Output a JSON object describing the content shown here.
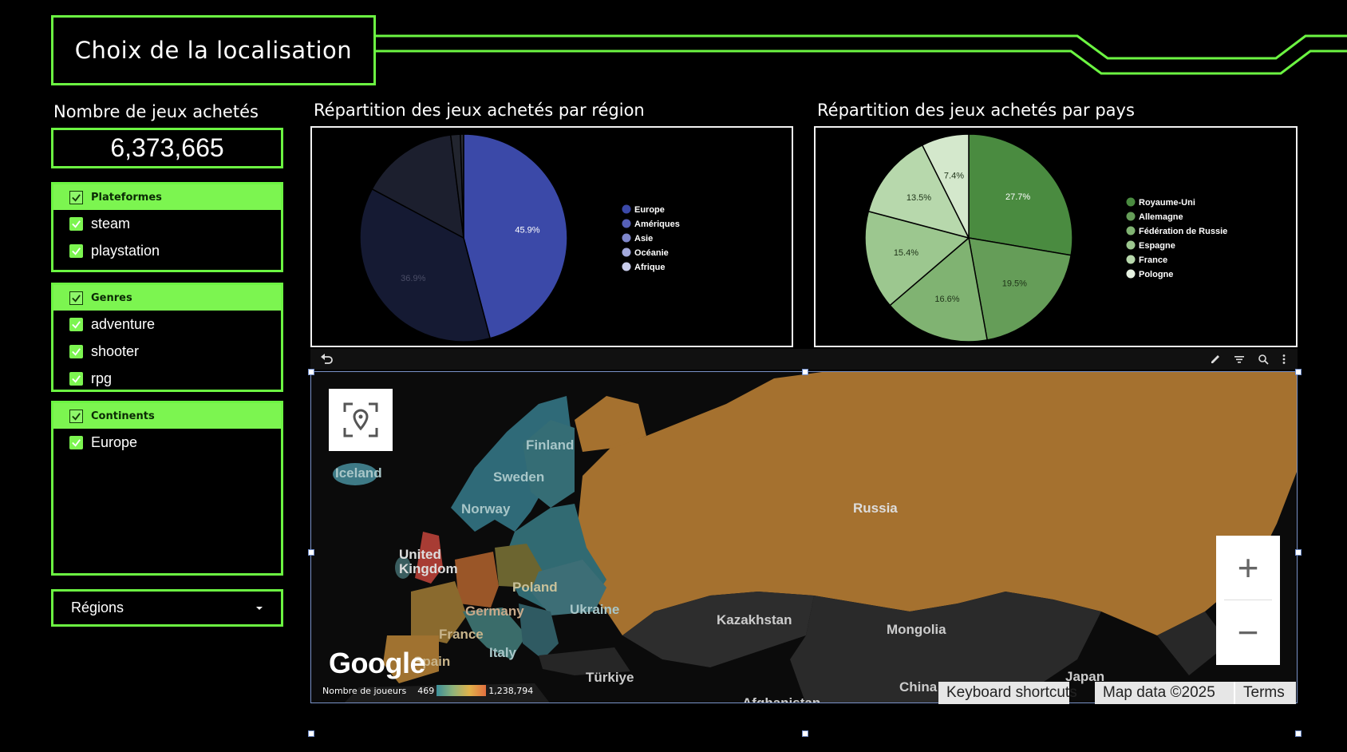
{
  "header": {
    "title": "Choix de la localisation"
  },
  "kpi": {
    "label": "Nombre de jeux achetés",
    "value": "6,373,665"
  },
  "filters": {
    "platforms": {
      "title": "Plateformes",
      "items": [
        "steam",
        "playstation"
      ]
    },
    "genres": {
      "title": "Genres",
      "items": [
        "adventure",
        "shooter",
        "rpg"
      ]
    },
    "continents": {
      "title": "Continents",
      "items": [
        "Europe"
      ]
    }
  },
  "dropdown": {
    "value": "Régions"
  },
  "charts": {
    "region": {
      "title": "Répartition des jeux achetés par région"
    },
    "country": {
      "title": "Répartition des jeux achetés par pays"
    }
  },
  "chart_data": [
    {
      "type": "pie",
      "title": "Répartition des jeux achetés par région",
      "categories": [
        "Europe",
        "Amériques",
        "Asie",
        "Océanie",
        "Afrique"
      ],
      "values": [
        45.9,
        36.9,
        15.2,
        1.5,
        0.5
      ],
      "labels": [
        "45.9%",
        "36.9%",
        "",
        "",
        ""
      ],
      "colors": [
        "#3b49a8",
        "#151a33",
        "#1c1f2e",
        "#22252f",
        "#2a2c36"
      ],
      "label_colors": [
        "#ffffff",
        "#4a4d66",
        "",
        "",
        ""
      ],
      "legend_colors": [
        "#3b49a8",
        "#5660b8",
        "#7f87cc",
        "#a3a9dc",
        "#c9cdec"
      ],
      "legend_position": "right"
    },
    {
      "type": "pie",
      "title": "Répartition des jeux achetés par pays",
      "categories": [
        "Royaume-Uni",
        "Allemagne",
        "Fédération de Russie",
        "Espagne",
        "France",
        "Pologne"
      ],
      "values": [
        27.7,
        19.5,
        16.6,
        15.4,
        13.5,
        7.4
      ],
      "labels": [
        "27.7%",
        "19.5%",
        "16.6%",
        "15.4%",
        "13.5%",
        "7.4%"
      ],
      "colors": [
        "#4a8b40",
        "#659d58",
        "#80b372",
        "#9cc78f",
        "#b7d8ac",
        "#d4e8cc"
      ],
      "label_colors": [
        "#ffffff",
        "#1e3318",
        "#1e3318",
        "#1e3318",
        "#1e3318",
        "#1e3318"
      ],
      "legend_colors": [
        "#4a8b40",
        "#659d58",
        "#80b372",
        "#9cc78f",
        "#b7d8ac",
        "#e6f1e1"
      ],
      "legend_position": "right"
    }
  ],
  "map": {
    "labels": [
      "Finland",
      "Iceland",
      "Sweden",
      "Norway",
      "United Kingdom",
      "Poland",
      "Germany",
      "Ukraine",
      "France",
      "Italy",
      "Spain",
      "Türkiye",
      "Russia",
      "Kazakhstan",
      "Mongolia",
      "China",
      "Japan",
      "Afghanistan"
    ],
    "google_logo": "Google",
    "attribution": {
      "shortcuts": "Keyboard shortcuts",
      "data": "Map data ©2025",
      "terms": "Terms"
    },
    "legend": {
      "label": "Nombre de joueurs",
      "min": "469",
      "max": "1,238,794"
    },
    "zoom": {
      "in": "+",
      "out": "−"
    }
  },
  "colors": {
    "accent": "#6cf542",
    "russia": "#b27a35",
    "uk": "#a83c34"
  },
  "icons": [
    "check-icon",
    "dropdown-arrow-icon",
    "undo-icon",
    "edit-icon",
    "filter-icon",
    "zoom-icon",
    "more-vert-icon",
    "locate-icon"
  ]
}
